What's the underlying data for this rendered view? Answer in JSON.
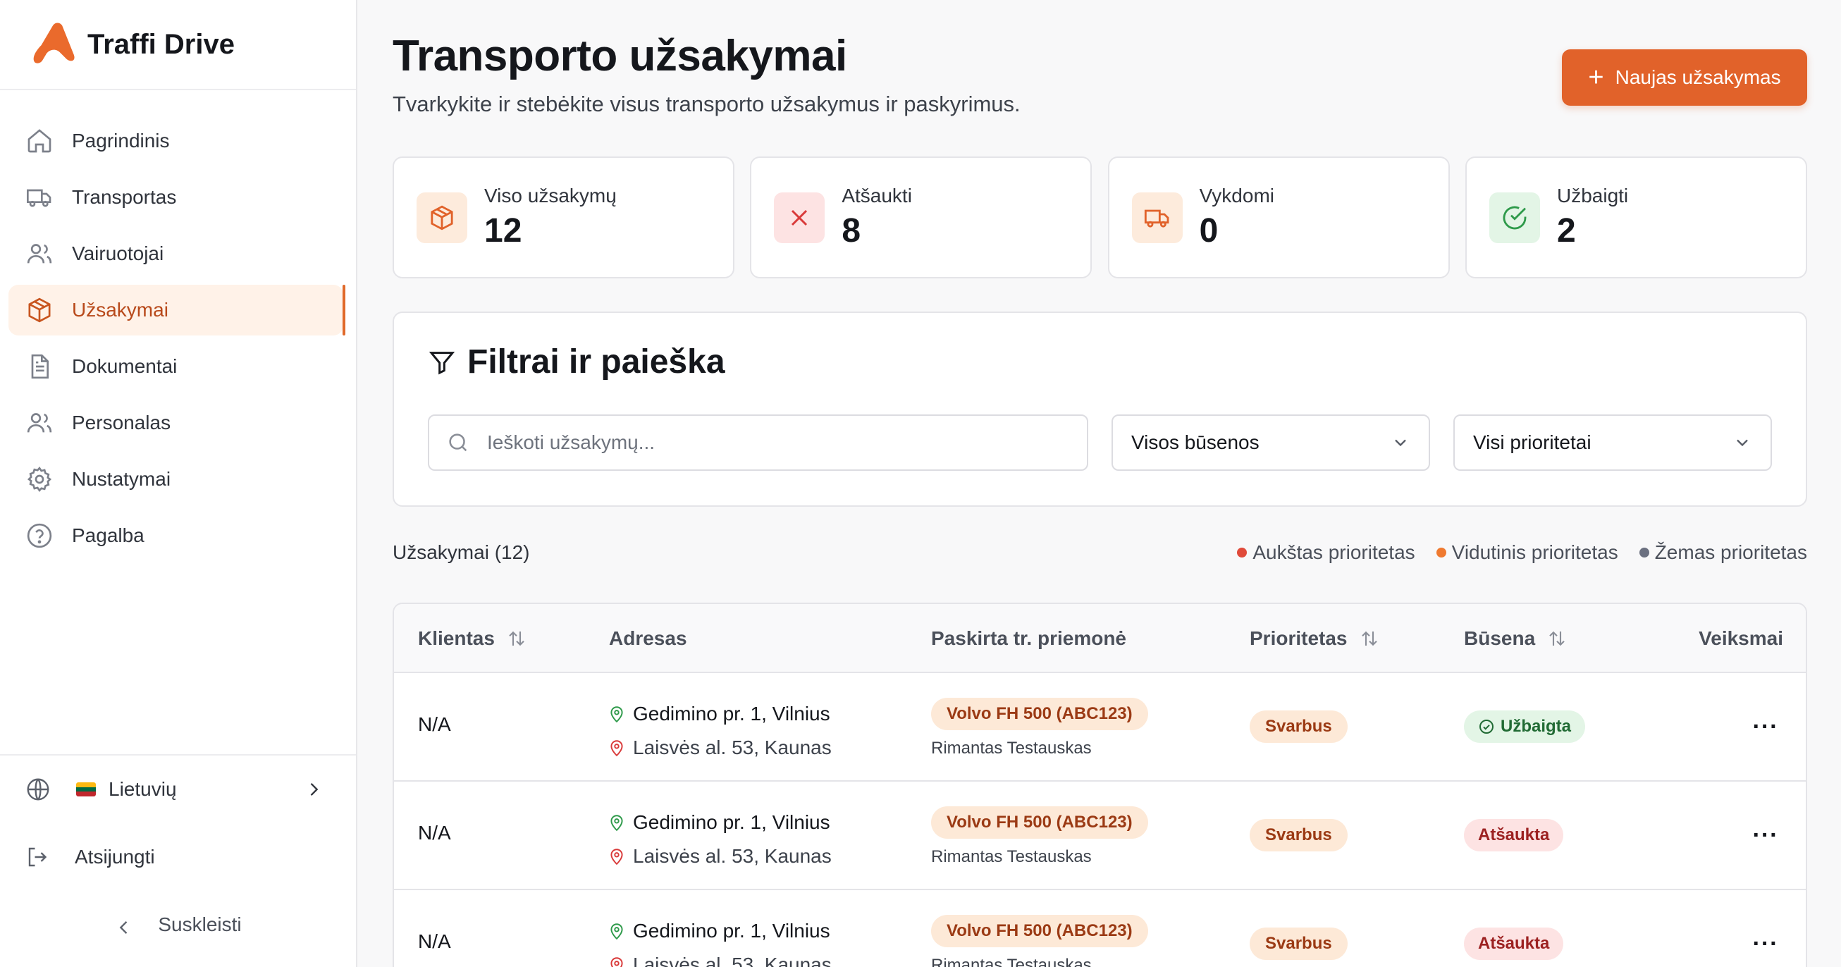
{
  "brand": {
    "name": "Traffi Drive",
    "accent": "#e1622a"
  },
  "sidebar": {
    "items": [
      {
        "label": "Pagrindinis",
        "icon": "home-icon",
        "active": false
      },
      {
        "label": "Transportas",
        "icon": "truck-icon",
        "active": false
      },
      {
        "label": "Vairuotojai",
        "icon": "users-icon",
        "active": false
      },
      {
        "label": "Užsakymai",
        "icon": "package-icon",
        "active": true
      },
      {
        "label": "Dokumentai",
        "icon": "document-icon",
        "active": false
      },
      {
        "label": "Personalas",
        "icon": "users-icon",
        "active": false
      },
      {
        "label": "Nustatymai",
        "icon": "gear-icon",
        "active": false
      },
      {
        "label": "Pagalba",
        "icon": "help-icon",
        "active": false
      }
    ],
    "language": "Lietuvių",
    "logout": "Atsijungti",
    "collapse": "Suskleisti"
  },
  "header": {
    "title": "Transporto užsakymai",
    "subtitle": "Tvarkykite ir stebėkite visus transporto užsakymus ir paskyrimus.",
    "new_button": "Naujas užsakymas"
  },
  "stats": [
    {
      "label": "Viso užsakymų",
      "value": "12",
      "icon": "package-icon",
      "color": "#e1622a",
      "bg": "#fdebdc"
    },
    {
      "label": "Atšaukti",
      "value": "8",
      "icon": "close-icon",
      "color": "#d93a3a",
      "bg": "#fde3e3"
    },
    {
      "label": "Vykdomi",
      "value": "0",
      "icon": "truck-icon",
      "color": "#e1622a",
      "bg": "#fdebdc"
    },
    {
      "label": "Užbaigti",
      "value": "2",
      "icon": "check-circle-icon",
      "color": "#2e9a4a",
      "bg": "#e3f5e6"
    }
  ],
  "filters": {
    "title": "Filtrai ir paieška",
    "search_placeholder": "Ieškoti užsakymų...",
    "status_value": "Visos būsenos",
    "priority_value": "Visi prioritetai"
  },
  "list": {
    "count_label": "Užsakymai (12)",
    "legend": [
      {
        "label": "Aukštas prioritetas",
        "color": "#e04a3a"
      },
      {
        "label": "Vidutinis prioritetas",
        "color": "#ef7a30"
      },
      {
        "label": "Žemas prioritetas",
        "color": "#6b7080"
      }
    ]
  },
  "table": {
    "columns": {
      "client": "Klientas",
      "address": "Adresas",
      "vehicle": "Paskirta tr. priemonė",
      "priority": "Prioritetas",
      "status": "Būsena",
      "actions": "Veiksmai"
    },
    "rows": [
      {
        "client": "N/A",
        "from": "Gedimino pr. 1, Vilnius",
        "to": "Laisvės al. 53, Kaunas",
        "vehicle": "Volvo FH 500 (ABC123)",
        "driver": "Rimantas Testauskas",
        "priority": "Svarbus",
        "status": "Užbaigta",
        "status_type": "done"
      },
      {
        "client": "N/A",
        "from": "Gedimino pr. 1, Vilnius",
        "to": "Laisvės al. 53, Kaunas",
        "vehicle": "Volvo FH 500 (ABC123)",
        "driver": "Rimantas Testauskas",
        "priority": "Svarbus",
        "status": "Atšaukta",
        "status_type": "cancel"
      },
      {
        "client": "N/A",
        "from": "Gedimino pr. 1, Vilnius",
        "to": "Laisvės al. 53, Kaunas",
        "vehicle": "Volvo FH 500 (ABC123)",
        "driver": "Rimantas Testauskas",
        "priority": "Svarbus",
        "status": "Atšaukta",
        "status_type": "cancel"
      }
    ]
  }
}
